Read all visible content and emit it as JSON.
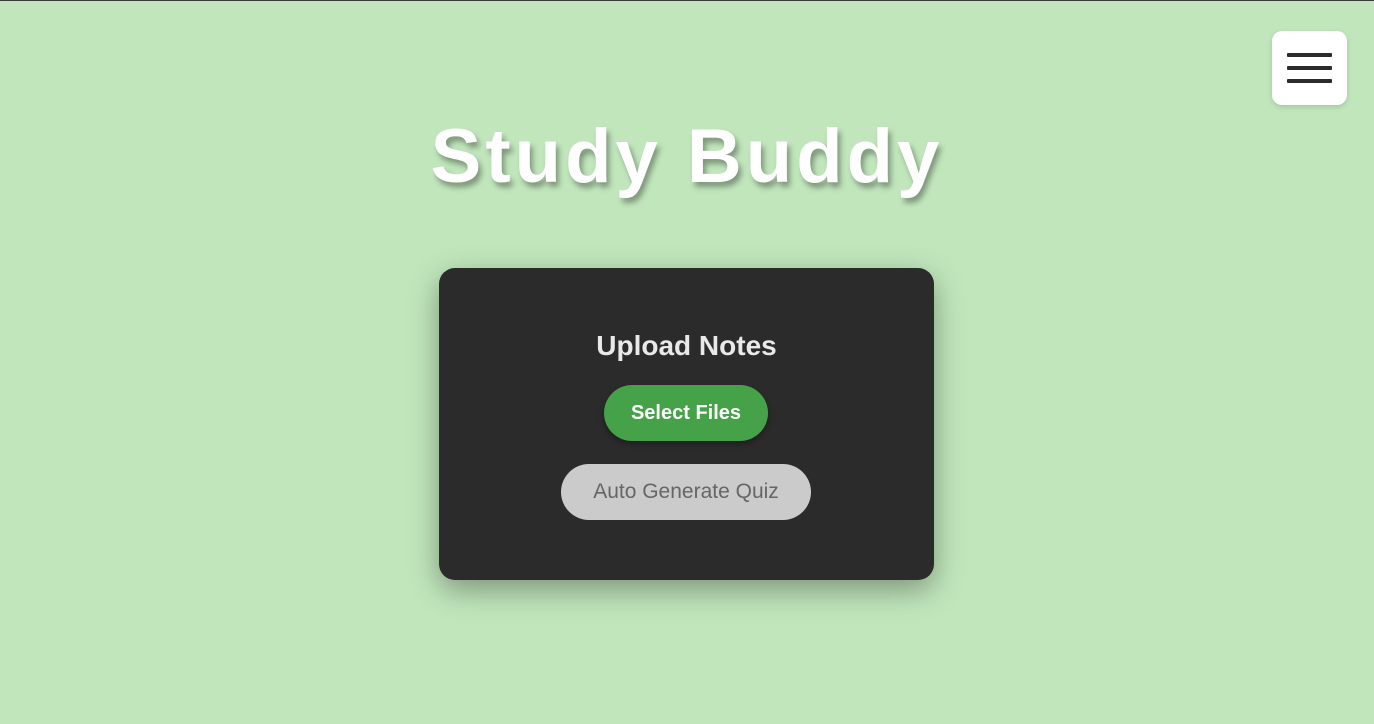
{
  "header": {
    "title": "Study Buddy"
  },
  "menu": {
    "icon": "hamburger-menu-icon"
  },
  "upload_card": {
    "title": "Upload Notes",
    "select_files_label": "Select Files",
    "auto_generate_label": "Auto Generate Quiz"
  },
  "colors": {
    "background": "#c1e6bc",
    "card": "#2b2b2b",
    "primary_button": "#45a248",
    "disabled_button": "#cbcbcb"
  }
}
